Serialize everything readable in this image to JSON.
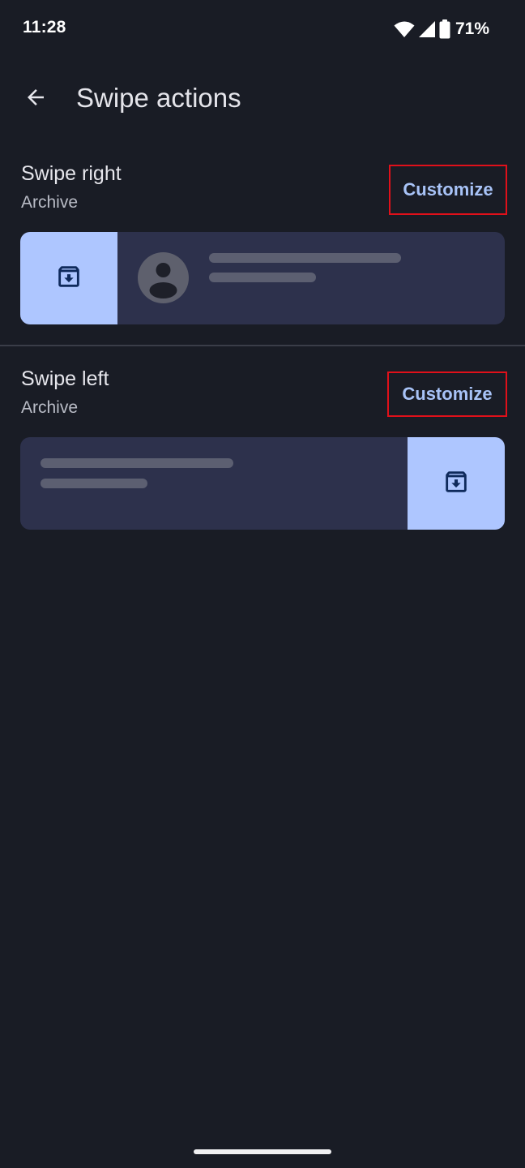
{
  "status_bar": {
    "time": "11:28",
    "battery_percent": "71%",
    "icons": [
      "wifi-icon",
      "cellular-signal-icon",
      "battery-icon"
    ]
  },
  "app_bar": {
    "back_icon": "arrow-left-icon",
    "title": "Swipe actions"
  },
  "sections": [
    {
      "title": "Swipe right",
      "value": "Archive",
      "button_label": "Customize",
      "action_icon": "archive-icon",
      "action_side": "left"
    },
    {
      "title": "Swipe left",
      "value": "Archive",
      "button_label": "Customize",
      "action_icon": "archive-icon",
      "action_side": "right"
    }
  ],
  "colors": {
    "background": "#191c25",
    "card": "#2d314c",
    "action_panel": "#aec6ff",
    "accent_text": "#a8c3f7",
    "highlight_border": "#e0101a"
  }
}
